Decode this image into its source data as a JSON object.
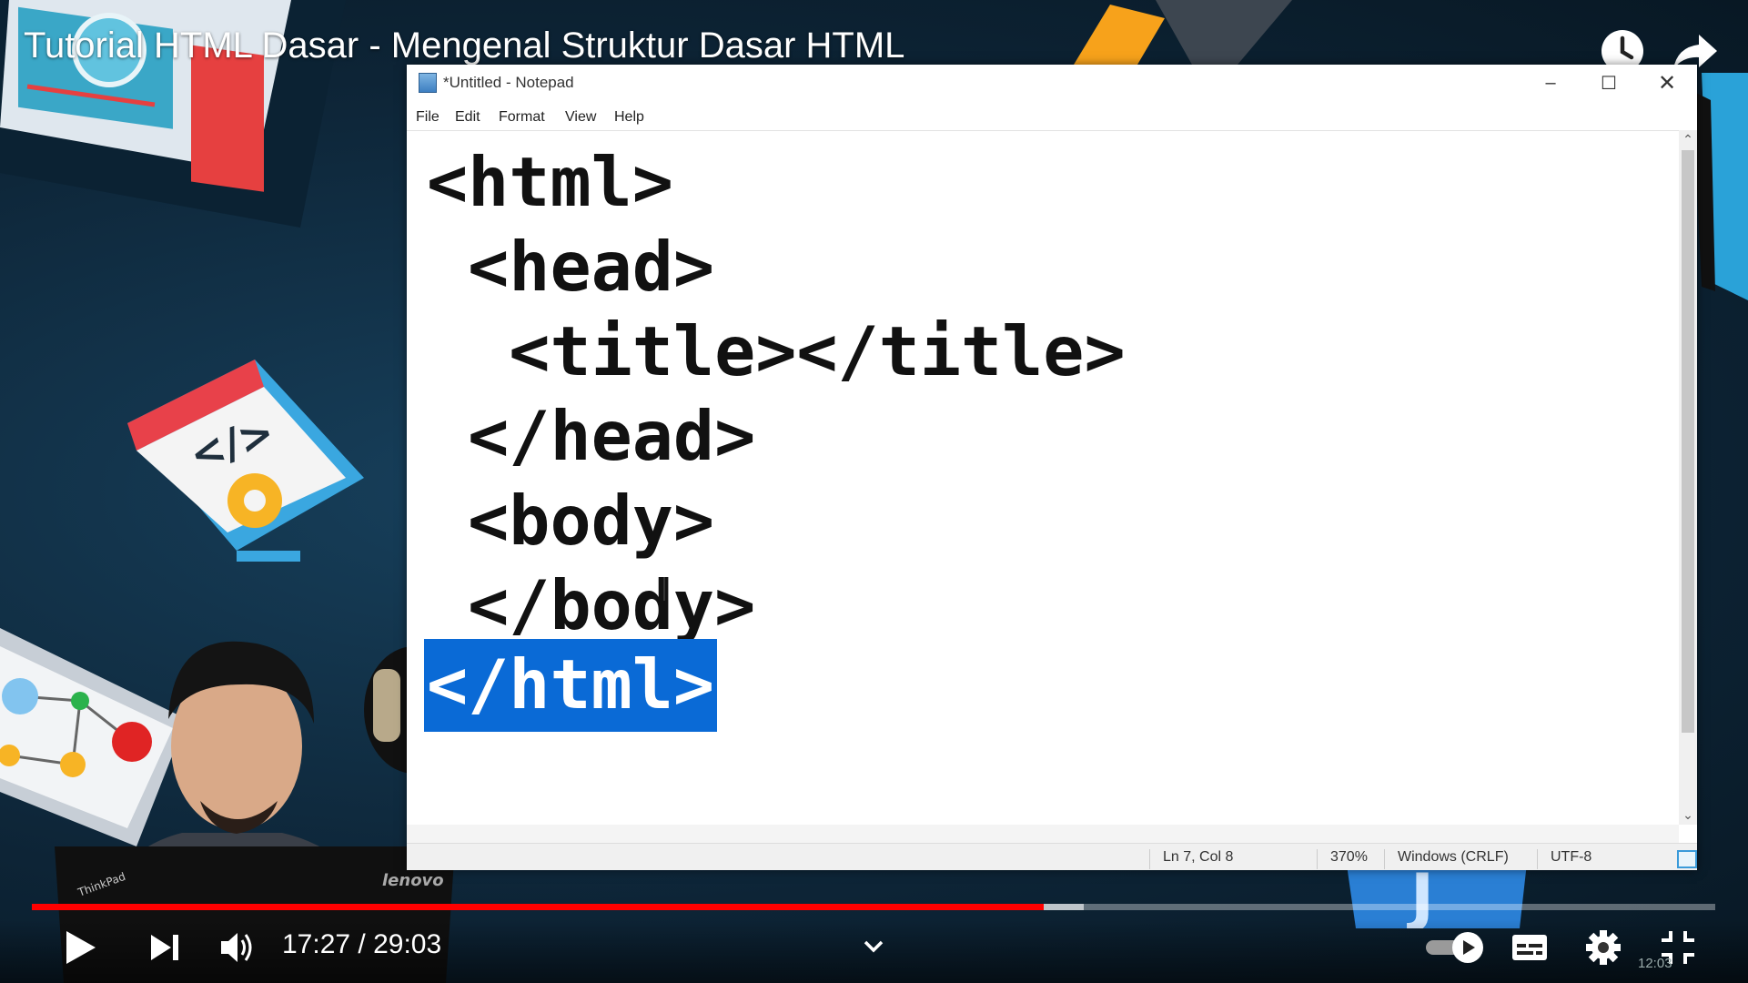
{
  "video": {
    "title": "Tutorial HTML Dasar - Mengenal Struktur Dasar HTML",
    "time_current": "17:27",
    "time_separator": " / ",
    "time_total": "29:03",
    "progress_fraction": 0.601,
    "buffered_fraction": 0.625
  },
  "notepad": {
    "window_title": "*Untitled - Notepad",
    "menu": [
      "File",
      "Edit",
      "Format",
      "View",
      "Help"
    ],
    "lines": [
      "<html>",
      " <head>",
      "  <title></title>",
      " </head>",
      " <body>",
      " </body>",
      "</html>"
    ],
    "selected_line_index": 6,
    "status": {
      "position": "Ln 7, Col 8",
      "zoom": "370%",
      "line_ending": "Windows (CRLF)",
      "encoding": "UTF-8"
    }
  },
  "laptop_brand": "lenovo",
  "laptop_sticker": "ThinkPad",
  "taskbar_clock": "12:03",
  "colors": {
    "progress_played": "#ff0000",
    "selection": "#0a6ad6",
    "background": "#102b40"
  },
  "icons": [
    "watch-later-icon",
    "share-icon",
    "play-icon",
    "next-icon",
    "volume-icon",
    "chevron-down-icon",
    "autoplay-toggle-icon",
    "subtitles-icon",
    "settings-icon",
    "exit-fullscreen-icon"
  ]
}
